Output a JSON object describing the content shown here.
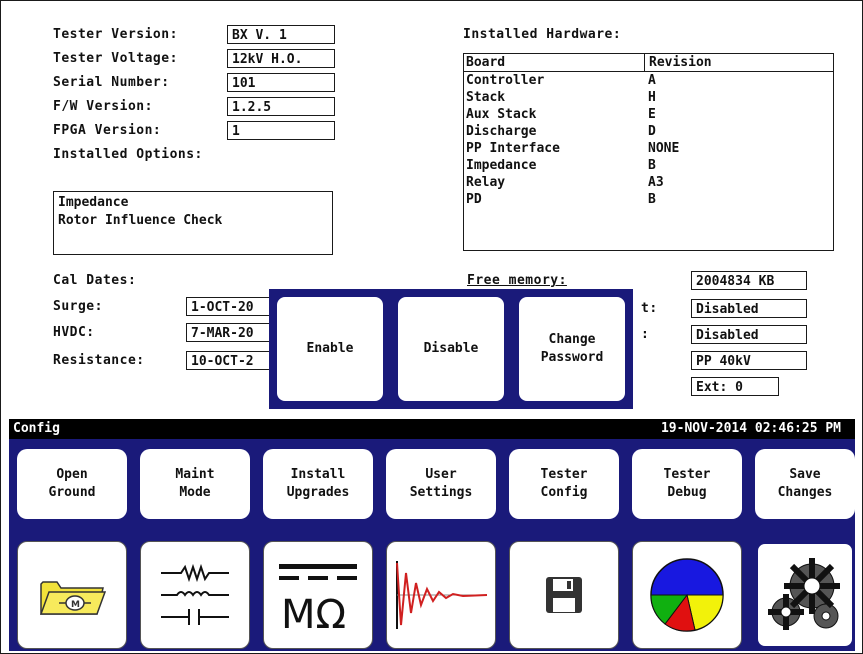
{
  "left_info": [
    {
      "label": "Tester Version:",
      "value": "BX V. 1"
    },
    {
      "label": "Tester Voltage:",
      "value": "12kV H.O."
    },
    {
      "label": "Serial Number:",
      "value": "101"
    },
    {
      "label": "F/W Version:",
      "value": "1.2.5"
    },
    {
      "label": "FPGA Version:",
      "value": "1"
    }
  ],
  "installed_options": {
    "label": "Installed Options:",
    "items": [
      "Impedance",
      "Rotor Influence Check"
    ]
  },
  "installed_hardware": {
    "label": "Installed Hardware:",
    "headers": [
      "Board",
      "Revision"
    ],
    "rows": [
      [
        "Controller",
        "A"
      ],
      [
        "Stack",
        "H"
      ],
      [
        "Aux Stack",
        "E"
      ],
      [
        "Discharge",
        "D"
      ],
      [
        "PP Interface",
        "NONE"
      ],
      [
        "Impedance",
        "B"
      ],
      [
        "Relay",
        "A3"
      ],
      [
        "PD",
        "B"
      ]
    ]
  },
  "cal_dates": {
    "label": "Cal Dates:",
    "rows": [
      {
        "label": "Surge:",
        "value": "1-OCT-20"
      },
      {
        "label": "HVDC:",
        "value": "7-MAR-20"
      },
      {
        "label": "Resistance:",
        "value": "10-OCT-2"
      }
    ]
  },
  "right_status": {
    "free_memory_label": "Free memory:",
    "label_frag_1": "t:",
    "label_frag_2": ":",
    "values": [
      "2004834 KB",
      "Disabled",
      "Disabled",
      "PP 40kV",
      "Ext: 0"
    ]
  },
  "popup": {
    "buttons": [
      "Enable",
      "Disable",
      "Change\nPassword"
    ]
  },
  "status_bar": {
    "title": "Config",
    "datetime": "19-NOV-2014 02:46:25 PM"
  },
  "toolbar": {
    "buttons": [
      "Open\nGround",
      "Maint\nMode",
      "Install\nUpgrades",
      "User\nSettings",
      "Tester\nConfig",
      "Tester\nDebug",
      "Save\nChanges"
    ]
  },
  "icon_bar": {
    "icons": [
      "folder-motor-icon",
      "circuit-icon",
      "megohm-icon",
      "waveform-icon",
      "floppy-disk-icon",
      "pie-chart-icon",
      "gears-icon"
    ],
    "megohm_symbol": "MΩ"
  },
  "colors": {
    "navy": "#1a1a7a",
    "status_bar": "#000000"
  }
}
